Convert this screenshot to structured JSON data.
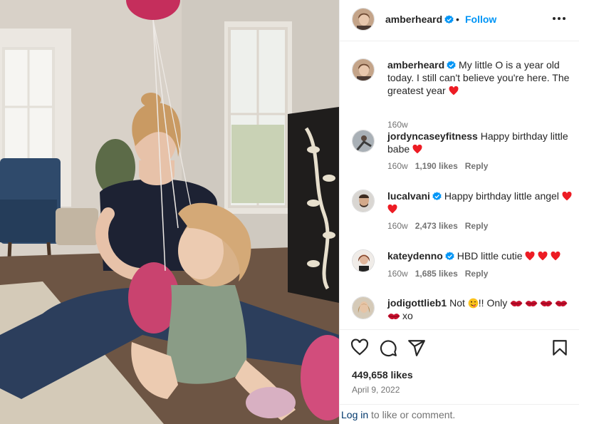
{
  "post": {
    "author": "amberheard",
    "follow_label": "Follow",
    "dot": "•",
    "caption": "My little O is a year old today. I still can't believe you're here. The greatest year",
    "caption_age": "160w",
    "photo_alt": "Woman sitting on the floor with a baby and pink balloons"
  },
  "comments": [
    {
      "user": "jordyncaseyfitness",
      "text": "Happy birthday little babe",
      "age": "160w",
      "likes": "1,190 likes",
      "reply": "Reply"
    },
    {
      "user": "lucalvani",
      "text": "Happy birthday little angel",
      "age": "160w",
      "likes": "2,473 likes",
      "reply": "Reply"
    },
    {
      "user": "kateydenno",
      "text": "HBD little cutie",
      "age": "160w",
      "likes": "1,685 likes",
      "reply": "Reply"
    },
    {
      "user": "jodigottlieb1",
      "text_a": "Not",
      "text_b": "!! Only",
      "text_c": "xo"
    }
  ],
  "footer": {
    "likes": "449,658 likes",
    "date": "April 9, 2022",
    "login_link": "Log in",
    "login_rest": " to like or comment."
  },
  "colors": {
    "link": "#0095f6",
    "verified": "#0095f6",
    "heart": "#ed1c24",
    "muted": "#737373"
  },
  "icons": [
    "heart-icon",
    "comment-icon",
    "share-icon",
    "bookmark-icon",
    "more-icon",
    "verified-badge-icon"
  ]
}
